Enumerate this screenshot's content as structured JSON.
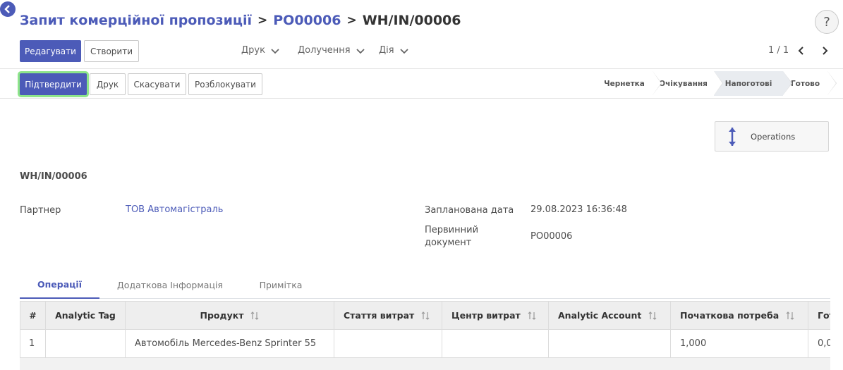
{
  "breadcrumb": {
    "items": [
      "Запит комерційної пропозиції",
      "PO00006"
    ],
    "current": "WH/IN/00006",
    "separator": ">"
  },
  "help": {
    "label": "?"
  },
  "control_panel": {
    "edit_label": "Редагувати",
    "create_label": "Створити",
    "print_menu": "Друк",
    "attachments_menu": "Долучення",
    "action_menu": "Дія",
    "pager": "1 / 1"
  },
  "header_buttons": {
    "confirm": "Підтвердити",
    "print": "Друк",
    "cancel": "Скасувати",
    "unlock": "Розблокувати"
  },
  "statusbar": {
    "stages": [
      "Чернетка",
      "Очікування",
      "Напоготові",
      "Готово"
    ],
    "active": "Напоготові"
  },
  "smart_button": {
    "label": "Operations"
  },
  "record": {
    "name": "WH/IN/00006",
    "partner_label": "Партнер",
    "partner_value": "ТОВ Автомагістраль",
    "scheduled_date_label": "Запланована дата",
    "scheduled_date_value": "29.08.2023 16:36:48",
    "source_doc_label_line1": "Первинний",
    "source_doc_label_line2": "документ",
    "source_doc_value": "PO00006"
  },
  "tabs": [
    "Операції",
    "Додаткова Інформація",
    "Примітка"
  ],
  "table": {
    "columns": [
      "#",
      "Analytic Tag",
      "Продукт",
      "Стаття витрат",
      "Центр витрат",
      "Analytic Account",
      "Початкова потреба",
      "Гот"
    ],
    "rows": [
      {
        "num": "1",
        "analytic_tag": "",
        "product": "Автомобіль Mercedes-Benz Sprinter 55",
        "cost_item": "",
        "cost_center": "",
        "analytic_account": "",
        "initial_demand": "1,000",
        "done": "0,0"
      }
    ]
  },
  "colors": {
    "primary": "#4c5bb8",
    "confirm_focus": "#8ee58a"
  }
}
